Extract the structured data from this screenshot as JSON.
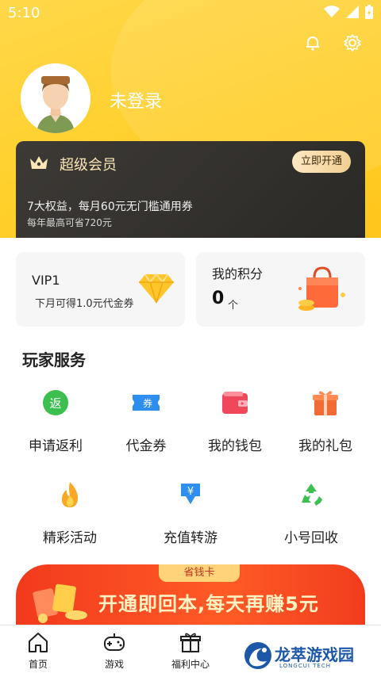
{
  "status_bar": {
    "time": "5:10"
  },
  "profile": {
    "username": "未登录"
  },
  "vip_card": {
    "title": "超级会员",
    "button": "立即开通",
    "line1": "7大权益，每月60元无门槛通用券",
    "line2": "每年最高可省720元"
  },
  "vip_level": {
    "title": "VIP1",
    "subtitle": "下月可得1.0元代金券"
  },
  "points": {
    "title": "我的积分",
    "value": "0",
    "unit": "个"
  },
  "services": {
    "title": "玩家服务",
    "row1": [
      {
        "label": "申请返利",
        "icon": "rebate-icon"
      },
      {
        "label": "代金券",
        "icon": "voucher-icon"
      },
      {
        "label": "我的钱包",
        "icon": "wallet-icon"
      },
      {
        "label": "我的礼包",
        "icon": "gift-icon"
      }
    ],
    "row2": [
      {
        "label": "精彩活动",
        "icon": "fire-icon"
      },
      {
        "label": "充值转游",
        "icon": "recharge-icon"
      },
      {
        "label": "小号回收",
        "icon": "recycle-icon"
      }
    ]
  },
  "banner": {
    "tag": "省钱卡",
    "text": "开通即回本,每天再赚5元"
  },
  "tabbar": [
    {
      "label": "首页",
      "icon": "home-icon"
    },
    {
      "label": "游戏",
      "icon": "gamepad-icon"
    },
    {
      "label": "福利中心",
      "icon": "gift-box-icon"
    }
  ],
  "watermark": {
    "brand": "龙萃游戏园",
    "sub": "LONGCUI TECH"
  },
  "colors": {
    "accent": "#ffcf2a",
    "vip_dark": "#2b2926",
    "banner_red": "#f23a1d"
  }
}
